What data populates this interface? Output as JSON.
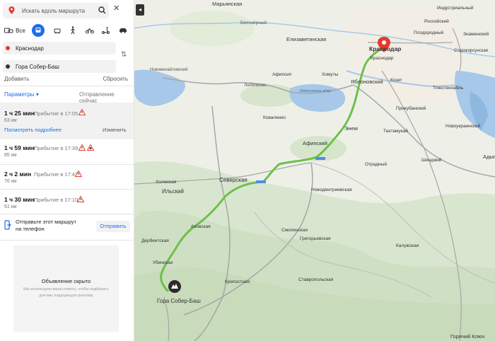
{
  "search": {
    "placeholder": "Искать вдоль маршрута"
  },
  "modes": {
    "all_label": "Все"
  },
  "route_points": {
    "from": "Краснодар",
    "to": "Гора Собер-Баш"
  },
  "actions": {
    "add": "Добавить",
    "reset": "Сбросить"
  },
  "params": {
    "label": "Параметры ▾",
    "departure": "Отправление сейчас"
  },
  "routes": [
    {
      "time": "1 ч 25 мин",
      "arrival": "Прибытие в 17:05",
      "km": "63 км",
      "more": "Посмотреть подробнее",
      "edit": "Изменить"
    },
    {
      "time": "1 ч 59 мин",
      "arrival": "Прибытие в 17:39",
      "km": "85 км"
    },
    {
      "time": "2 ч 2 мин",
      "arrival": "Прибытие в 17:42",
      "km": "76 км"
    },
    {
      "time": "1 ч 30 мин",
      "arrival": "Прибытие в 17:10",
      "km": "61 км"
    }
  ],
  "send": {
    "text": "Отправьте этот маршрут на телефон",
    "button": "Отправить"
  },
  "ad": {
    "title": "Объявление скрыто",
    "text": "Мы используем ваши ответы, чтобы подбирать для вас подходящую рекламу"
  },
  "map_labels": {
    "maryanskaya": "Марьянская",
    "belozerny": "Белозёрный",
    "elizavetinskaya": "Елизаветинская",
    "krasnodar": "Краснодар",
    "krasnodar_big": "Краснодар",
    "afipsip": "Афипсип",
    "yablonovsky": "Яблоновский",
    "komuty": "Хомуты",
    "shapsugskoe": "Шапсугское вдхр.",
    "kovalenko": "Коваленко",
    "enem": "Энем",
    "afipsky": "Афипский",
    "takhtamukay": "Тахтамукай",
    "prikubansky": "Прикубанский",
    "kozet": "Козет",
    "otradny": "Отрадный",
    "shendzhiy": "Шенджий",
    "severskaya": "Северская",
    "ilsky": "Ильский",
    "novodmitrievskaya": "Новодмитриевская",
    "azovskaya": "Азовская",
    "smolenskaya": "Смоленская",
    "grigorievskaya": "Григорьевская",
    "kaluzhskaya": "Калужская",
    "derbentskaya": "Дербентская",
    "ubinskaya": "Убинская",
    "krepostnaya": "Крепостная",
    "stavropolskaya": "Ставропольская",
    "gora": "Гора Собер-Баш",
    "goryachy": "Горячий Ключ",
    "novomikhaylovsky": "Новомихайловский",
    "lyubimovo": "Любимово",
    "adygeysk": "Адыг",
    "industrialny": "Индустриальный",
    "plodorodny": "Плодородный",
    "znamensky": "Знаменский",
    "tlostenkhabl": "Тлюстенхабль",
    "rossiysky": "Российский",
    "starokorsunskaya": "Старокорсунская",
    "novoukrainsky": "Новоукраинский",
    "kholmskaya": "Холмская"
  }
}
